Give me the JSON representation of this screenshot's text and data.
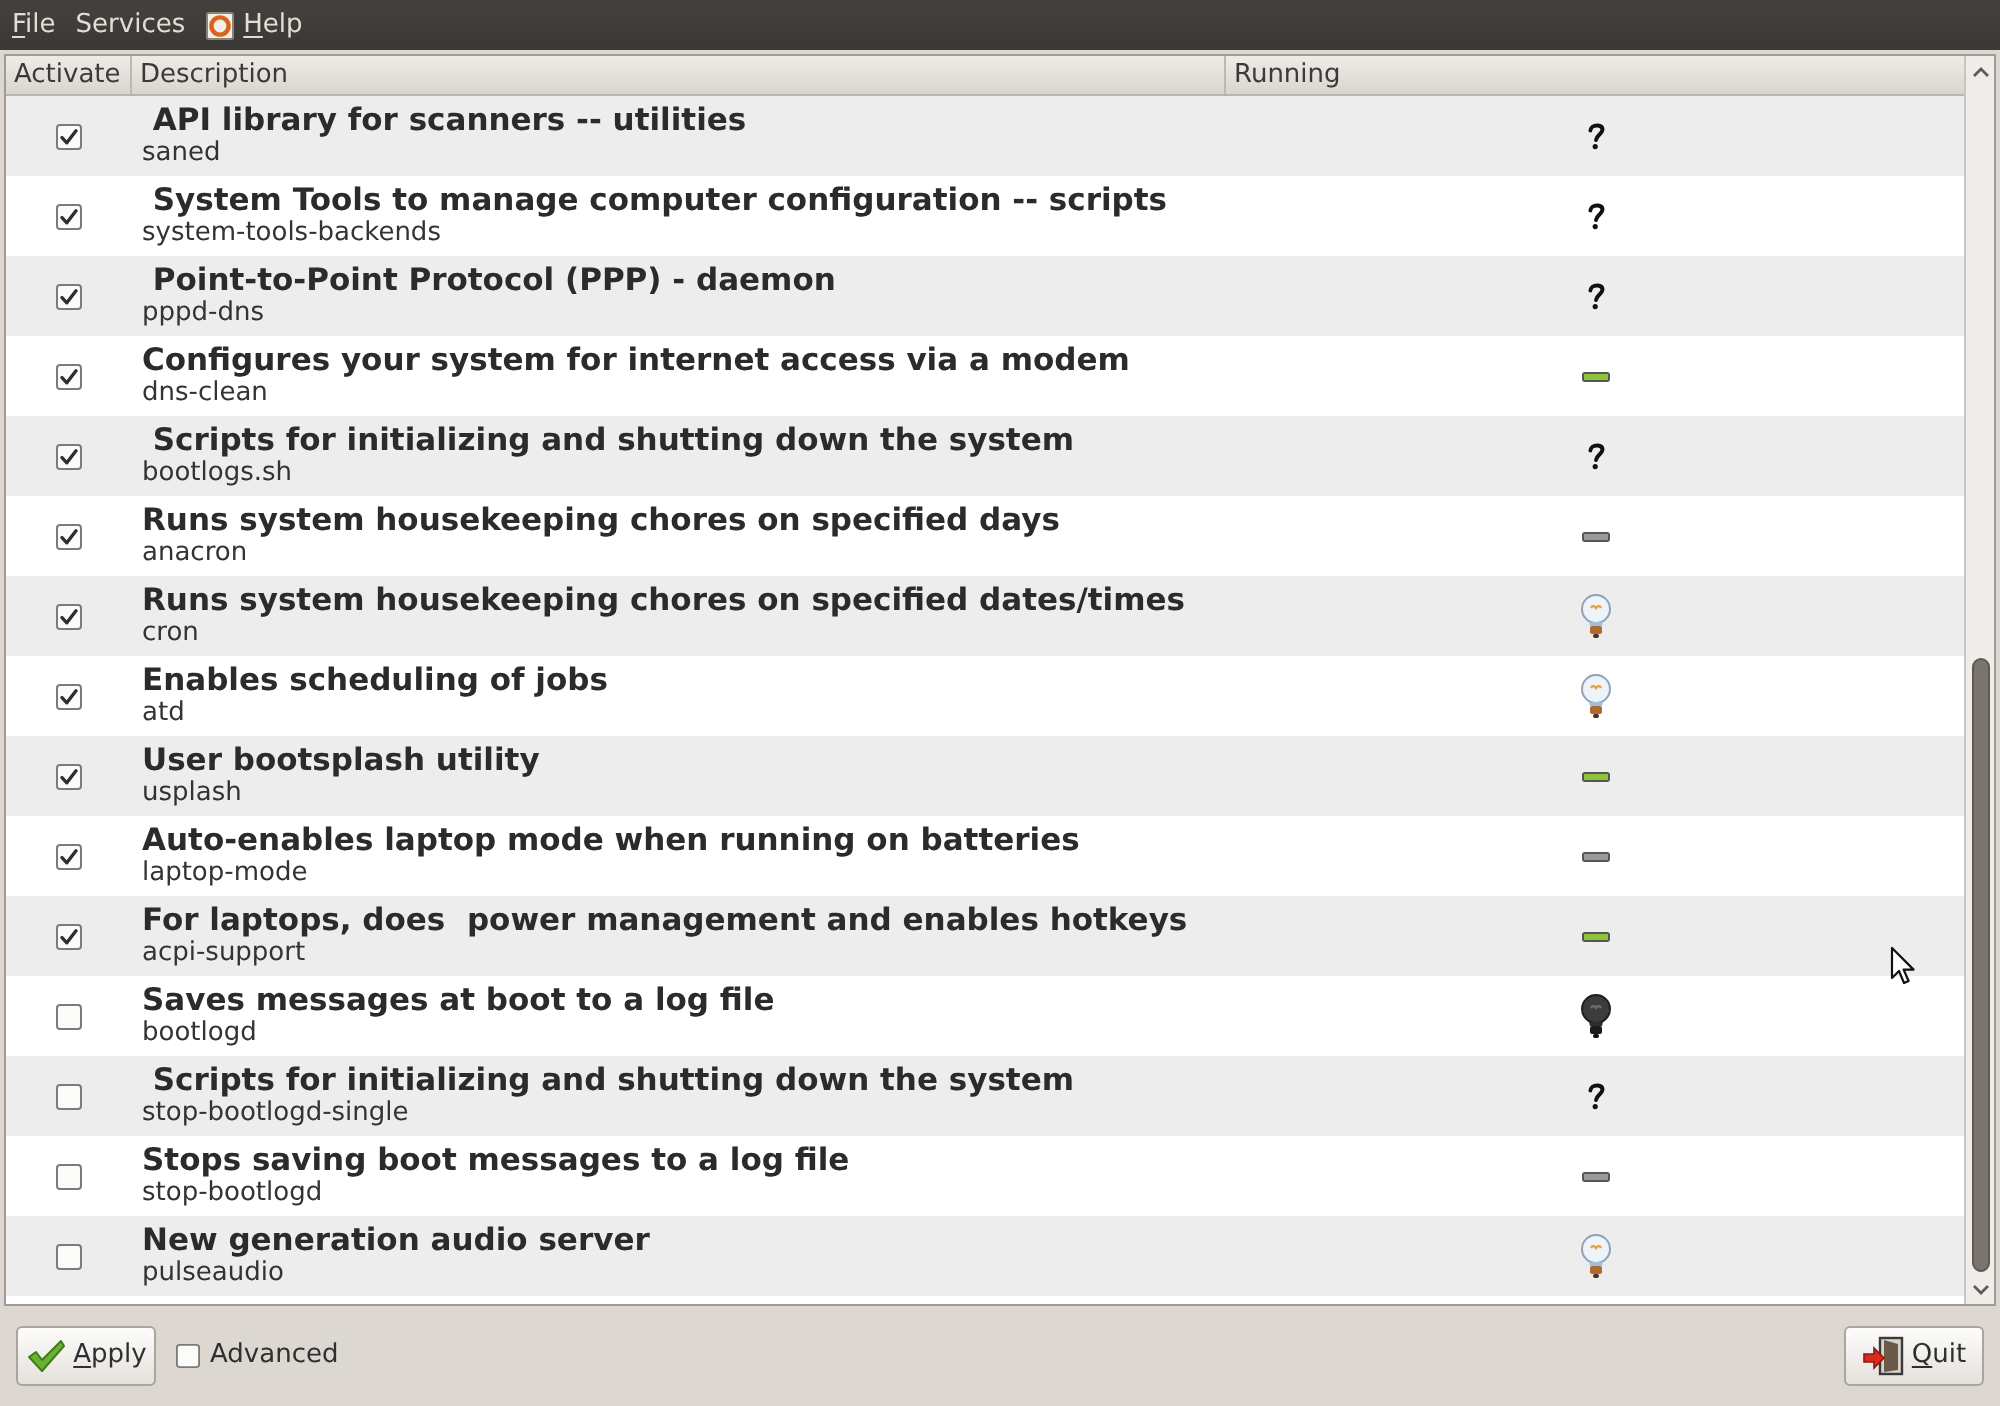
{
  "menubar": [
    {
      "label": "File",
      "mnemonic": true,
      "icon": false
    },
    {
      "label": "Services",
      "mnemonic": false,
      "icon": false
    },
    {
      "label": "Help",
      "mnemonic": true,
      "icon": true
    }
  ],
  "columns": [
    "Activate",
    "Description",
    "Running"
  ],
  "rows": [
    {
      "checked": true,
      "title": " API library for scanners -- utilities",
      "name": "saned",
      "running": {
        "kind": "unknown"
      }
    },
    {
      "checked": true,
      "title": " System Tools to manage computer configuration -- scripts",
      "name": "system-tools-backends",
      "running": {
        "kind": "unknown"
      }
    },
    {
      "checked": true,
      "title": " Point-to-Point Protocol (PPP) - daemon",
      "name": "pppd-dns",
      "running": {
        "kind": "unknown"
      }
    },
    {
      "checked": true,
      "title": "Configures your system for internet access via a modem",
      "name": "dns-clean",
      "running": {
        "kind": "idle",
        "color": "#8cc43c"
      }
    },
    {
      "checked": true,
      "title": " Scripts for initializing and shutting down the system",
      "name": "bootlogs.sh",
      "running": {
        "kind": "unknown"
      }
    },
    {
      "checked": true,
      "title": "Runs system housekeeping chores on specified days",
      "name": "anacron",
      "running": {
        "kind": "idle",
        "color": "#9a9a9a"
      }
    },
    {
      "checked": true,
      "title": "Runs system housekeeping chores on specified dates/times",
      "name": "cron",
      "running": {
        "kind": "running"
      }
    },
    {
      "checked": true,
      "title": "Enables scheduling of jobs",
      "name": "atd",
      "running": {
        "kind": "running"
      }
    },
    {
      "checked": true,
      "title": "User bootsplash utility",
      "name": "usplash",
      "running": {
        "kind": "idle",
        "color": "#8cc43c"
      }
    },
    {
      "checked": true,
      "title": "Auto-enables laptop mode when running on batteries",
      "name": "laptop-mode",
      "running": {
        "kind": "idle",
        "color": "#9a9a9a"
      }
    },
    {
      "checked": true,
      "title": "For laptops, does  power management and enables hotkeys",
      "name": "acpi-support",
      "running": {
        "kind": "idle",
        "color": "#8cc43c"
      }
    },
    {
      "checked": false,
      "title": "Saves messages at boot to a log file",
      "name": "bootlogd",
      "running": {
        "kind": "stopped"
      }
    },
    {
      "checked": false,
      "title": " Scripts for initializing and shutting down the system",
      "name": "stop-bootlogd-single",
      "running": {
        "kind": "unknown"
      }
    },
    {
      "checked": false,
      "title": "Stops saving boot messages to a log file",
      "name": "stop-bootlogd",
      "running": {
        "kind": "idle",
        "color": "#9a9a9a"
      }
    },
    {
      "checked": false,
      "title": "New generation audio server",
      "name": "pulseaudio",
      "running": {
        "kind": "running"
      }
    }
  ],
  "footer": {
    "apply": {
      "label": "Apply",
      "mnemonic": true
    },
    "advanced": {
      "label": "Advanced",
      "checked": false
    },
    "quit": {
      "label": "Quit",
      "mnemonic": true
    }
  }
}
